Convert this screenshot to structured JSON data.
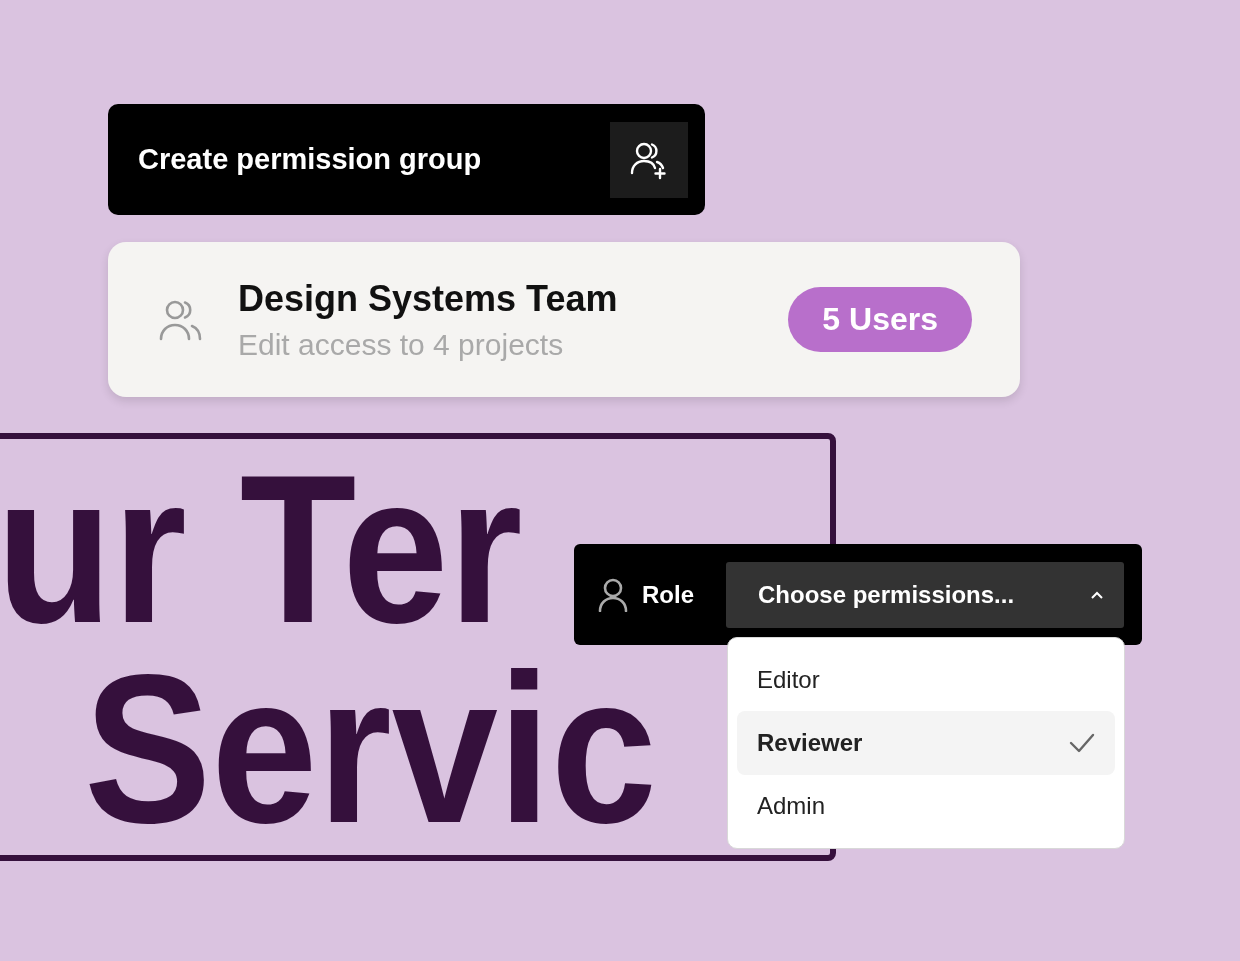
{
  "create_group": {
    "label": "Create permission group"
  },
  "group_card": {
    "title": "Design Systems Team",
    "subtitle": "Edit access to 4 projects",
    "badge": "5 Users"
  },
  "background_text": {
    "lines": [
      "ur Ter",
      "Servic"
    ]
  },
  "role_picker": {
    "label": "Role",
    "value": "Choose permissions...",
    "expanded": true,
    "options": [
      {
        "label": "Editor",
        "selected": false
      },
      {
        "label": "Reviewer",
        "selected": true
      },
      {
        "label": "Admin",
        "selected": false
      }
    ]
  }
}
